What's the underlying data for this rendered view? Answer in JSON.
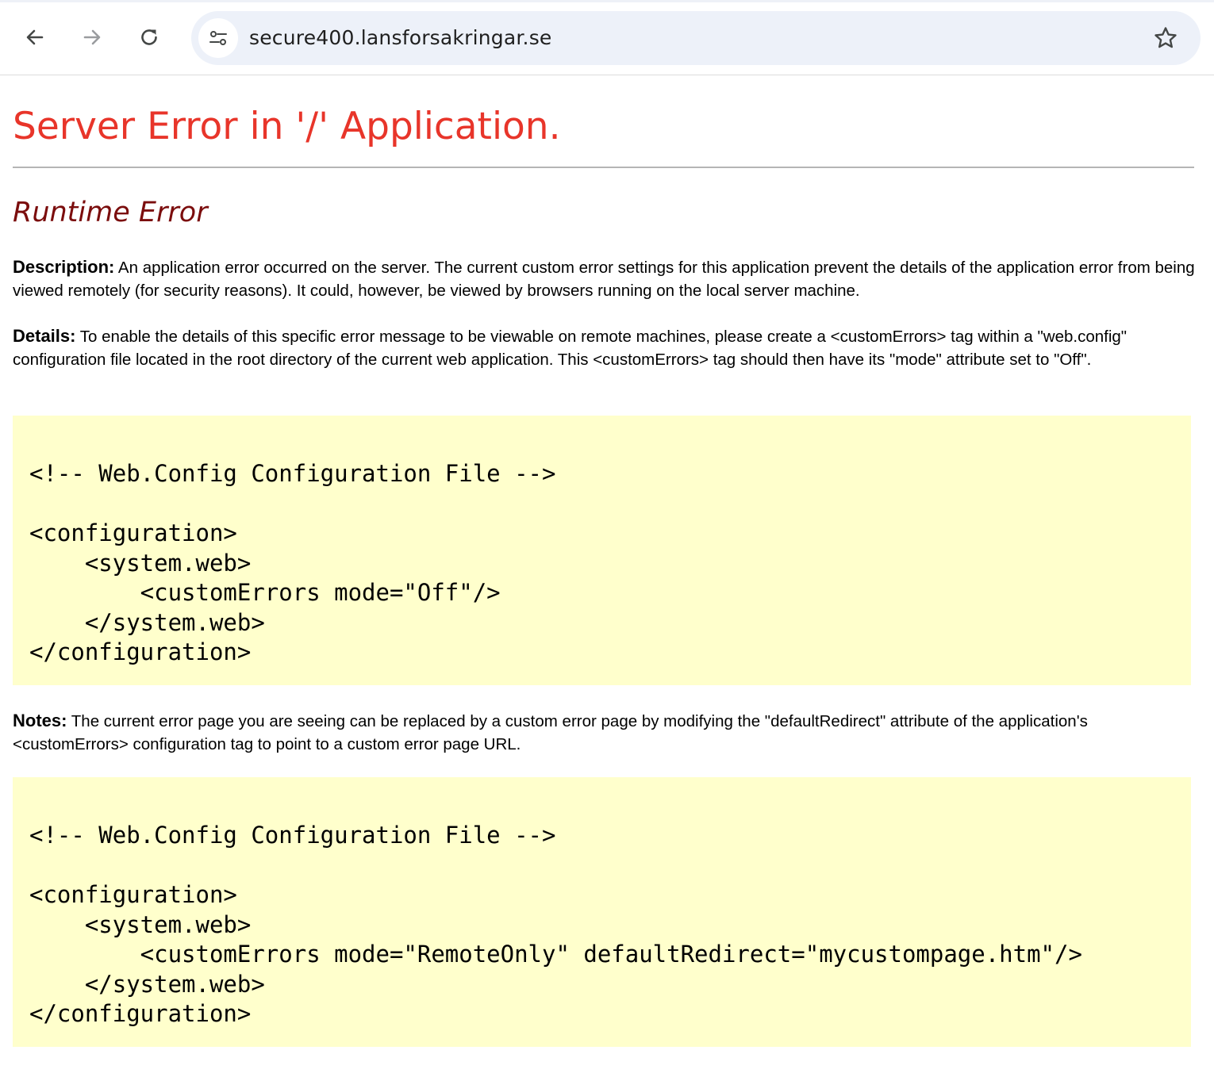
{
  "browser": {
    "url": "secure400.lansforsakringar.se"
  },
  "page": {
    "title": "Server Error in '/' Application.",
    "subtitle": "Runtime Error",
    "description": {
      "label": "Description:",
      "text": " An application error occurred on the server. The current custom error settings for this application prevent the details of the application error from being viewed remotely (for security reasons). It could, however, be viewed by browsers running on the local server machine."
    },
    "details": {
      "label": "Details:",
      "text": " To enable the details of this specific error message to be viewable on remote machines, please create a <customErrors> tag within a \"web.config\" configuration file located in the root directory of the current web application. This <customErrors> tag should then have its \"mode\" attribute set to \"Off\"."
    },
    "code1": "<!-- Web.Config Configuration File -->\n\n<configuration>\n    <system.web>\n        <customErrors mode=\"Off\"/>\n    </system.web>\n</configuration>",
    "notes": {
      "label": "Notes:",
      "text": " The current error page you are seeing can be replaced by a custom error page by modifying the \"defaultRedirect\" attribute of the application's <customErrors> configuration tag to point to a custom error page URL."
    },
    "code2": "<!-- Web.Config Configuration File -->\n\n<configuration>\n    <system.web>\n        <customErrors mode=\"RemoteOnly\" defaultRedirect=\"mycustompage.htm\"/>\n    </system.web>\n</configuration>"
  },
  "icons": {
    "back": "arrow-left-icon",
    "forward": "arrow-right-icon",
    "reload": "reload-icon",
    "site_info": "tune-icon",
    "bookmark": "star-icon"
  },
  "colors": {
    "title": "#e8352a",
    "subtitle": "#7b0d0d",
    "code_background": "#ffffcc",
    "omnibox": "#edf1f9"
  }
}
